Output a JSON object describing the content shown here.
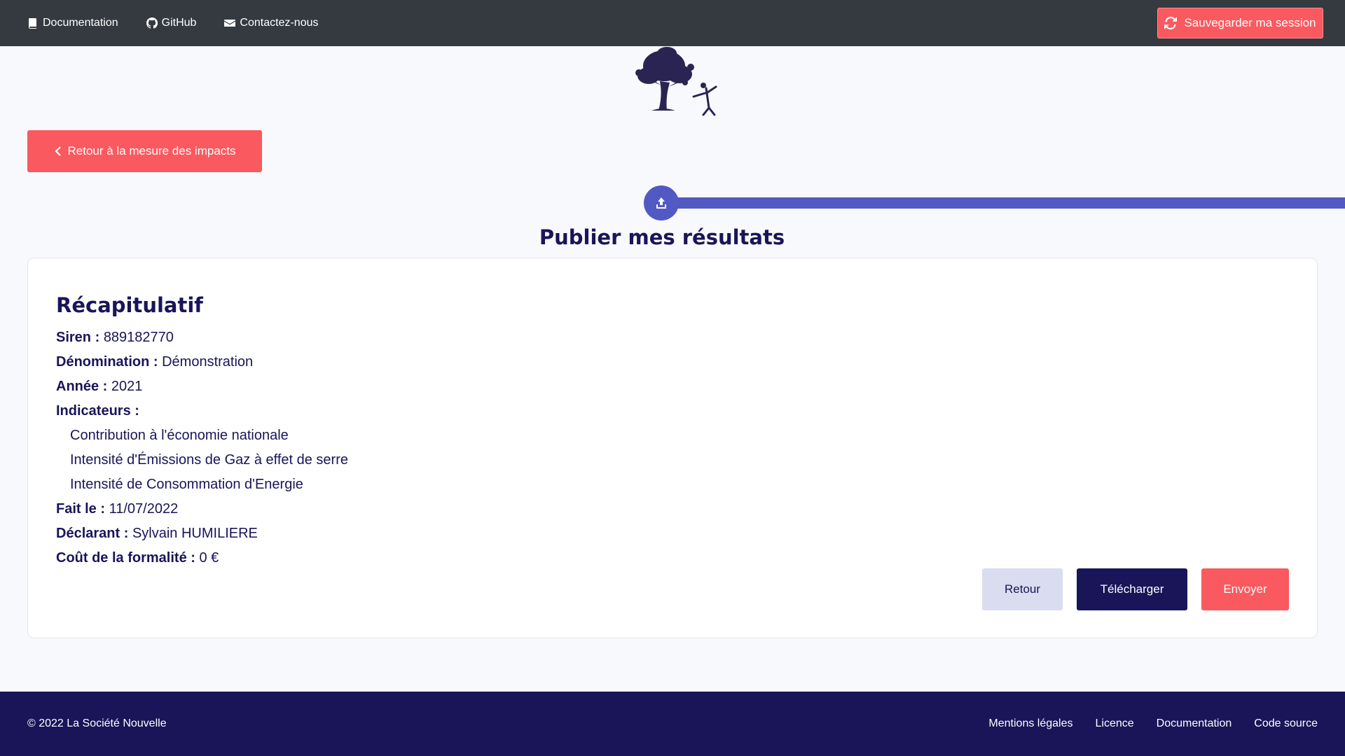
{
  "topnav": {
    "links": [
      {
        "label": "Documentation",
        "icon": "book-icon"
      },
      {
        "label": "GitHub",
        "icon": "github-icon"
      },
      {
        "label": "Contactez-nous",
        "icon": "envelope-icon"
      }
    ],
    "save_label": "Sauvegarder ma session"
  },
  "back_label": "Retour à la mesure des impacts",
  "step": {
    "icon": "upload-icon"
  },
  "page_title": "Publier mes résultats",
  "summary": {
    "title": "Récapitulatif",
    "siren_label": "Siren :",
    "siren": "889182770",
    "denomination_label": "Dénomination :",
    "denomination": "Démonstration",
    "year_label": "Année :",
    "year": "2021",
    "indicators_label": "Indicateurs :",
    "indicators": [
      "Contribution à l'économie nationale",
      "Intensité d'Émissions de Gaz à effet de serre",
      "Intensité de Consommation d'Energie"
    ],
    "date_label": "Fait le :",
    "date": "11/07/2022",
    "declarant_label": "Déclarant :",
    "declarant": "Sylvain HUMILIERE",
    "cost_label": "Coût de la formalité :",
    "cost": "0 €"
  },
  "actions": {
    "back": "Retour",
    "download": "Télécharger",
    "send": "Envoyer"
  },
  "footer": {
    "copyright": "© 2022 La Société Nouvelle",
    "links": [
      "Mentions légales",
      "Licence",
      "Documentation",
      "Code source"
    ]
  },
  "colors": {
    "accent": "#fa595f",
    "primary": "#191558",
    "progress": "#5259c2",
    "nav": "#343a40"
  }
}
